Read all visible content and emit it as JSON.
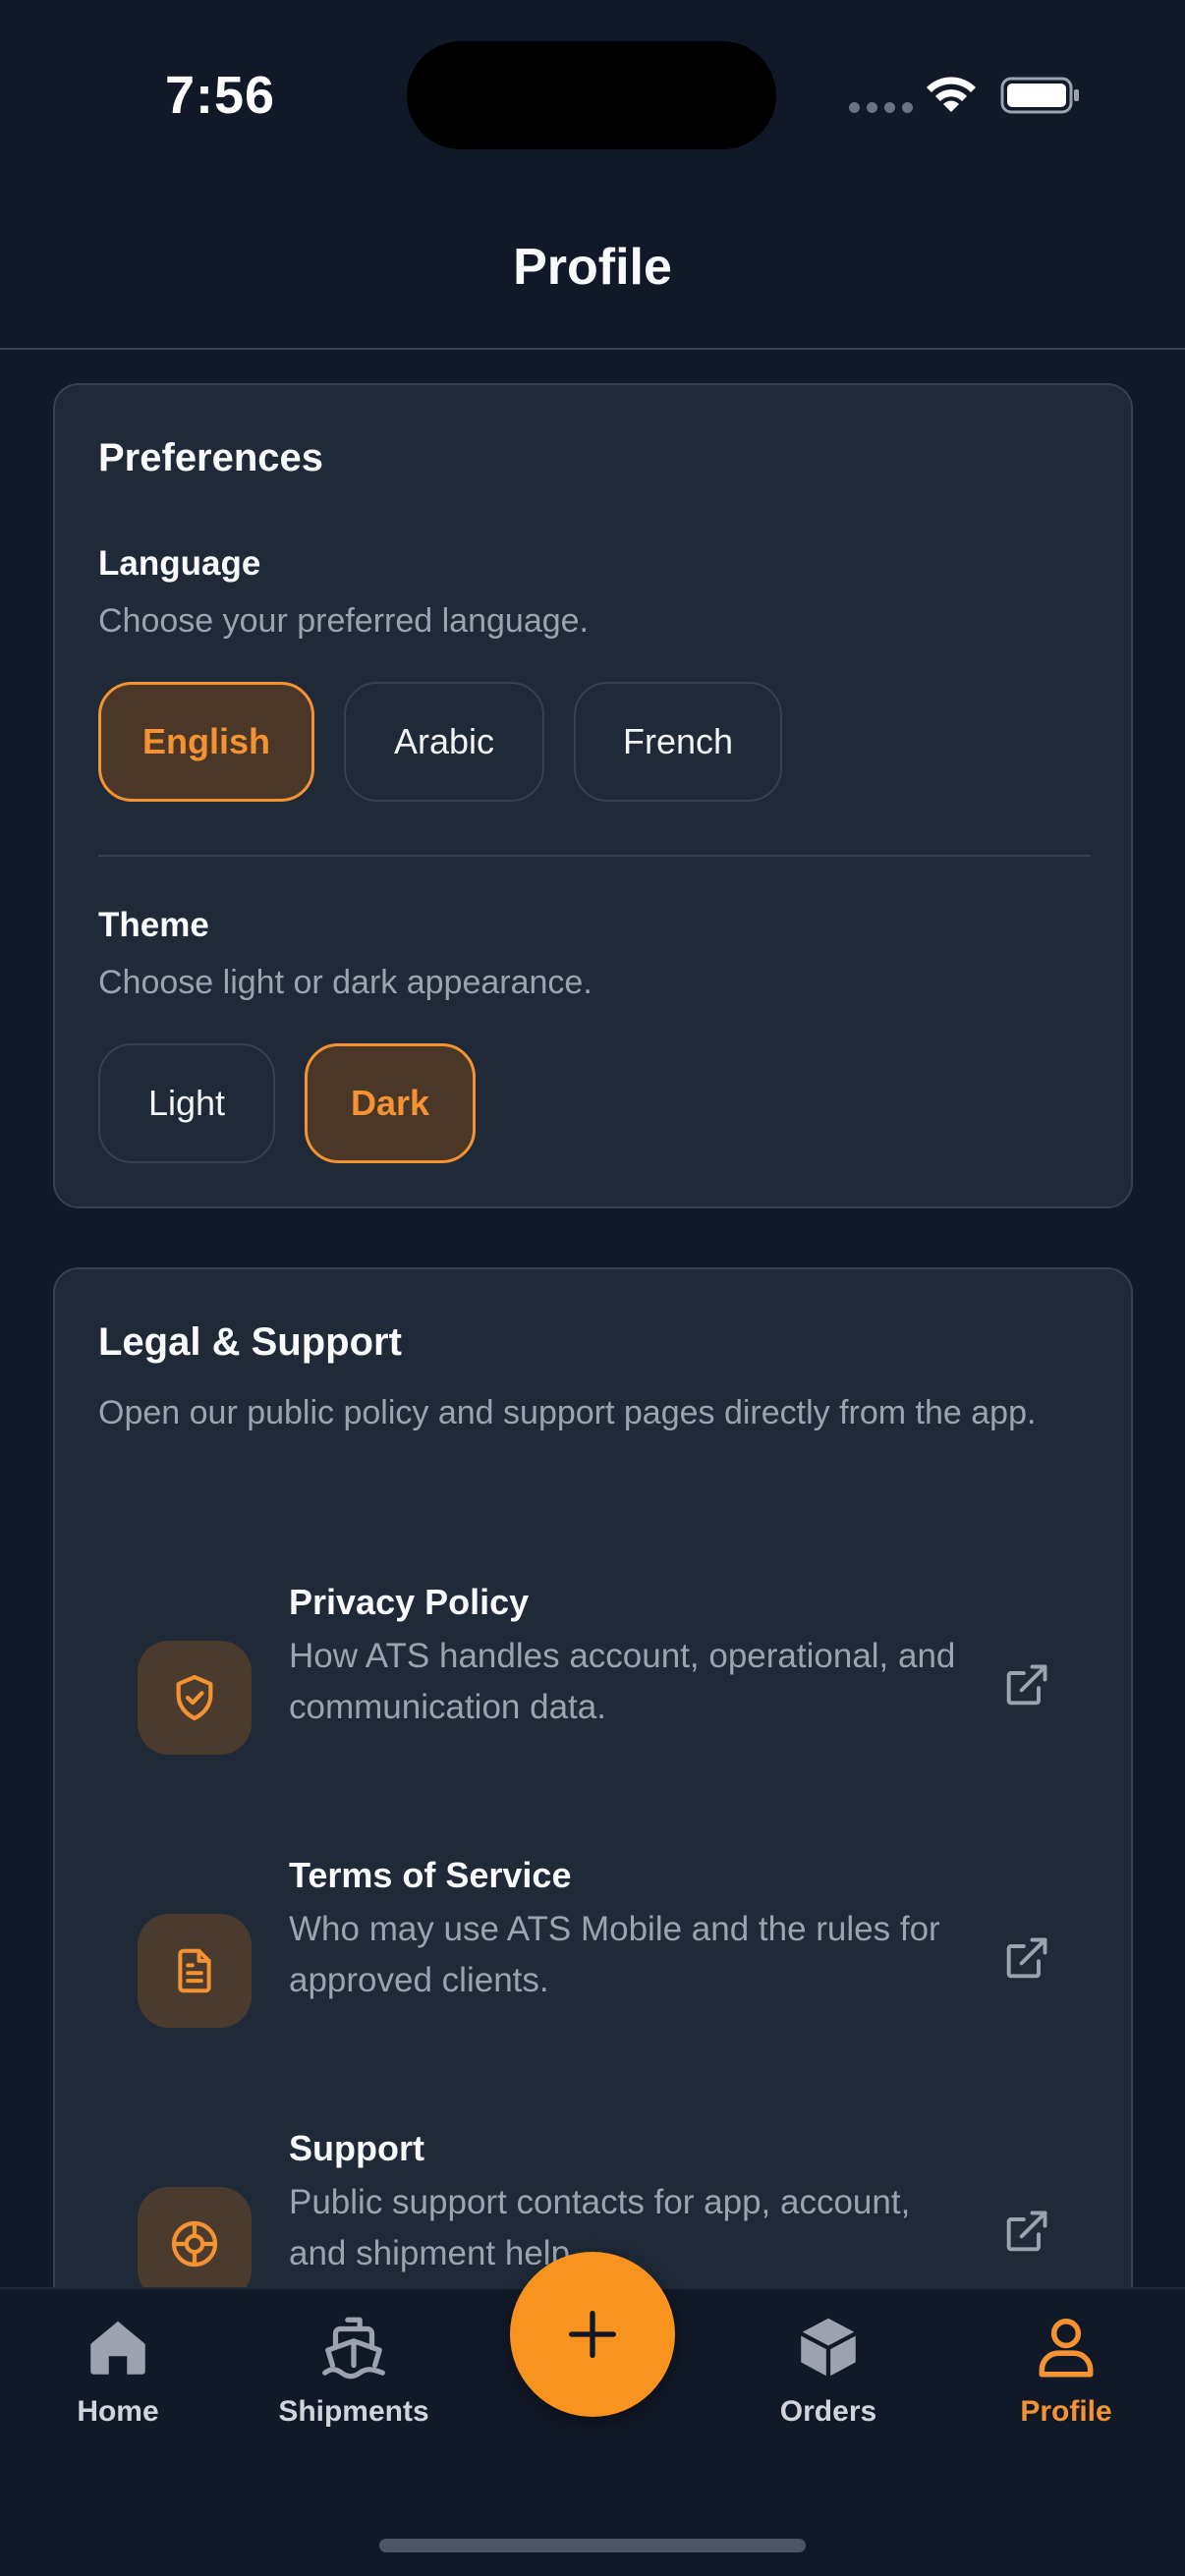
{
  "status_bar": {
    "time": "7:56"
  },
  "header": {
    "title": "Profile"
  },
  "preferences": {
    "title": "Preferences",
    "language": {
      "label": "Language",
      "description": "Choose your preferred language.",
      "options": [
        "English",
        "Arabic",
        "French"
      ],
      "selected": "English"
    },
    "theme": {
      "label": "Theme",
      "description": "Choose light or dark appearance.",
      "options": [
        "Light",
        "Dark"
      ],
      "selected": "Dark"
    }
  },
  "legal": {
    "title": "Legal & Support",
    "description": "Open our public policy and support pages directly from the app.",
    "items": [
      {
        "title": "Privacy Policy",
        "description": "How ATS handles account, operational, and communication data.",
        "icon": "shield-check-icon"
      },
      {
        "title": "Terms of Service",
        "description": "Who may use ATS Mobile and the rules for approved clients.",
        "icon": "document-icon"
      },
      {
        "title": "Support",
        "description": "Public support contacts for app, account, and shipment help.",
        "icon": "lifebuoy-icon"
      }
    ]
  },
  "nav": {
    "items": [
      {
        "label": "Home",
        "icon": "home-icon"
      },
      {
        "label": "Shipments",
        "icon": "ship-icon"
      },
      {
        "label": "Orders",
        "icon": "box-icon"
      },
      {
        "label": "Profile",
        "icon": "user-icon"
      }
    ],
    "active": "Profile",
    "fab_icon": "plus-icon"
  },
  "colors": {
    "accent": "#F7931E",
    "background": "#111827",
    "card": "#1F2937",
    "muted_text": "#9CA3AF"
  }
}
